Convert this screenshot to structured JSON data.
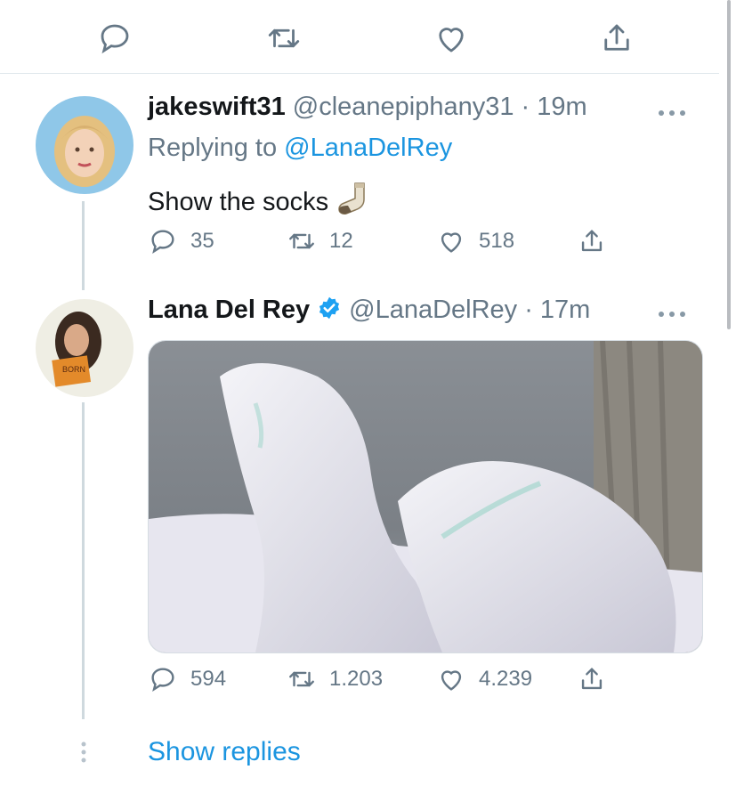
{
  "top_actions": {
    "icons": [
      "reply-icon",
      "retweet-icon",
      "like-icon",
      "share-icon"
    ]
  },
  "tweets": [
    {
      "display_name": "jakeswift31",
      "handle": "@cleanepiphany31",
      "separator": "·",
      "time": "19m",
      "replying_prefix": "Replying to",
      "replying_to": "@LanaDelRey",
      "text": "Show the socks",
      "emoji": "sock-icon",
      "replies": "35",
      "retweets": "12",
      "likes": "518"
    },
    {
      "display_name": "Lana Del Rey",
      "verified": true,
      "handle": "@LanaDelRey",
      "separator": "·",
      "time": "17m",
      "media": "photo of feet in white socks",
      "replies": "594",
      "retweets": "1.203",
      "likes": "4.239"
    }
  ],
  "show_replies": "Show replies",
  "colors": {
    "link": "#1b95e0",
    "muted": "#657786",
    "verified": "#1da1f2",
    "divider": "#e1e8ed"
  }
}
